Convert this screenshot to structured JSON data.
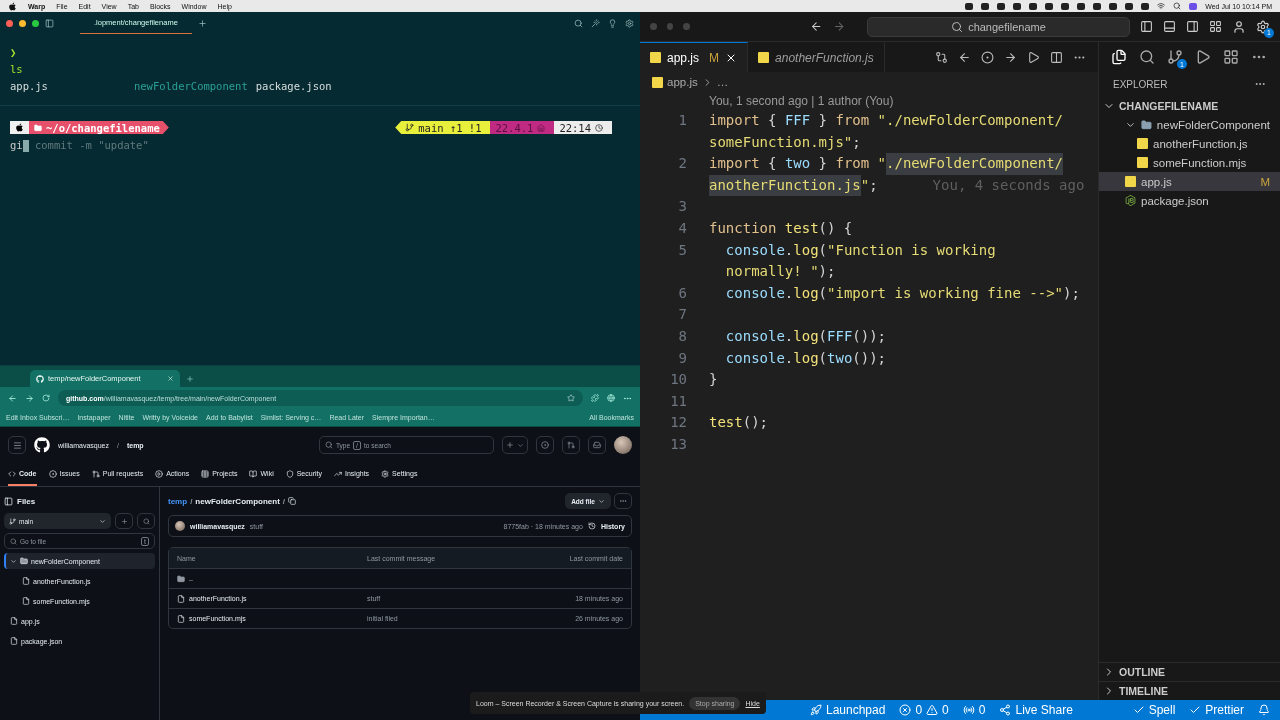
{
  "menubar": {
    "app_name": "Warp",
    "menus": [
      "File",
      "Edit",
      "View",
      "Tab",
      "Blocks",
      "Window",
      "Help"
    ],
    "clock": "Wed Jul 10  10:14 PM"
  },
  "terminal": {
    "tab_title": ".lopment/changefilename",
    "prompt_symbol": "❯",
    "command": "ls",
    "output": [
      {
        "text": "app.js",
        "kind": "file"
      },
      {
        "text": "newFolderComponent",
        "kind": "dir"
      },
      {
        "text": "package.json",
        "kind": "file"
      }
    ],
    "prompt": {
      "path": "~/o/changefilename",
      "branch": "main ↑1 !1",
      "node": "22.4.1",
      "time": "22:14"
    },
    "input": {
      "typed": "gi",
      "suggestion": " commit -m \"update\""
    }
  },
  "browser": {
    "tab_title": "temp/newFolderComponent",
    "url_host": "github.com",
    "url_path": "/williamavasquez/temp/tree/main/newFolderComponent",
    "bookmarks": [
      "Edit Inbox Subscri…",
      "Instapaper",
      "Nitite",
      "Writty by Voiceide",
      "Add to Babylist",
      "Simlist: Serving c…",
      "Read Later",
      "Siempre Importan…"
    ],
    "all_bookmarks": "All Bookmarks"
  },
  "github": {
    "owner": "williamavasquez",
    "separator": "/",
    "repo": "temp",
    "search": {
      "before": "Type",
      "key": "/",
      "after": "to search"
    },
    "nav": [
      {
        "label": "Code",
        "selected": true
      },
      {
        "label": "Issues",
        "selected": false
      },
      {
        "label": "Pull requests",
        "selected": false
      },
      {
        "label": "Actions",
        "selected": false
      },
      {
        "label": "Projects",
        "selected": false
      },
      {
        "label": "Wiki",
        "selected": false
      },
      {
        "label": "Security",
        "selected": false
      },
      {
        "label": "Insights",
        "selected": false
      },
      {
        "label": "Settings",
        "selected": false
      }
    ],
    "files_title": "Files",
    "branch": "main",
    "go_to_file": {
      "placeholder": "Go to file",
      "key": "t"
    },
    "tree": [
      {
        "name": "newFolderComponent",
        "kind": "folder",
        "expanded": true,
        "selected": true,
        "children": [
          {
            "name": "anotherFunction.js",
            "kind": "file",
            "selected": false
          },
          {
            "name": "someFunction.mjs",
            "kind": "file",
            "selected": false
          }
        ]
      },
      {
        "name": "app.js",
        "kind": "file",
        "selected": false
      },
      {
        "name": "package.json",
        "kind": "file",
        "selected": false
      }
    ],
    "breadcrumb": [
      "temp",
      "newFolderComponent"
    ],
    "add_file": "Add file",
    "commit": {
      "author": "williamavasquez",
      "message": "stuff",
      "hash": "8775fab · 18 minutes ago",
      "history": "History"
    },
    "table": {
      "columns": [
        "Name",
        "Last commit message",
        "Last commit date"
      ],
      "rows": [
        {
          "kind": "parent",
          "name": ".."
        },
        {
          "kind": "file",
          "name": "anotherFunction.js",
          "message": "stuff",
          "date": "18 minutes ago"
        },
        {
          "kind": "file",
          "name": "someFunction.mjs",
          "message": "initial filed",
          "date": "26 minutes ago"
        }
      ]
    }
  },
  "vscode": {
    "search": "changefilename",
    "settings_badge": "1",
    "scm_badge": "1",
    "tabs": [
      {
        "label": "app.js",
        "status": "M",
        "selected": true,
        "preview": false
      },
      {
        "label": "anotherFunction.js",
        "selected": false,
        "preview": true
      }
    ],
    "breadcrumb": [
      "app.js",
      "…"
    ],
    "codelens": "You, 1 second ago | 1 author (You)",
    "lines": [
      {
        "number": "1",
        "rows": [
          {
            "tokens": [
              {
                "kind": "keyword",
                "text": "import"
              },
              {
                "kind": "punct",
                "text": " { "
              },
              {
                "kind": "variable",
                "text": "FFF"
              },
              {
                "kind": "punct",
                "text": " } "
              },
              {
                "kind": "keyword",
                "text": "from"
              },
              {
                "kind": "string",
                "text": " \"./newFolderComponent/"
              }
            ]
          },
          {
            "tokens": [
              {
                "kind": "string",
                "text": "someFunction.mjs\""
              },
              {
                "kind": "punct",
                "text": ";"
              }
            ]
          }
        ]
      },
      {
        "number": "2",
        "rows": [
          {
            "tokens": [
              {
                "kind": "keyword",
                "text": "import"
              },
              {
                "kind": "punct",
                "text": " { "
              },
              {
                "kind": "variable",
                "text": "two"
              },
              {
                "kind": "punct",
                "text": " } "
              },
              {
                "kind": "keyword",
                "text": "from"
              },
              {
                "kind": "string",
                "text": " \""
              },
              {
                "kind": "selection",
                "text": "./newFolderComponent/"
              }
            ]
          },
          {
            "tokens": [
              {
                "kind": "selection",
                "text": "anotherFunction.js"
              },
              {
                "kind": "string",
                "text": "\""
              },
              {
                "kind": "punct",
                "text": ";"
              }
            ]
          }
        ],
        "blame": "You, 4 seconds ago"
      },
      {
        "number": "3"
      },
      {
        "number": "4",
        "rows": [
          {
            "tokens": [
              {
                "kind": "keyword",
                "text": "function "
              },
              {
                "kind": "function",
                "text": "test"
              },
              {
                "kind": "punct",
                "text": "() {"
              }
            ]
          }
        ]
      },
      {
        "number": "5",
        "rows": [
          {
            "tokens": [
              {
                "kind": "variable",
                "text": "  console"
              },
              {
                "kind": "punct",
                "text": "."
              },
              {
                "kind": "function",
                "text": "log"
              },
              {
                "kind": "punct",
                "text": "("
              },
              {
                "kind": "string",
                "text": "\"Function is working"
              }
            ]
          },
          {
            "tokens": [
              {
                "kind": "string",
                "text": "  normally! \""
              },
              {
                "kind": "punct",
                "text": ");"
              }
            ]
          }
        ]
      },
      {
        "number": "6",
        "rows": [
          {
            "tokens": [
              {
                "kind": "variable",
                "text": "  console"
              },
              {
                "kind": "punct",
                "text": "."
              },
              {
                "kind": "function",
                "text": "log"
              },
              {
                "kind": "punct",
                "text": "("
              },
              {
                "kind": "string",
                "text": "\"import is working fine -->\""
              },
              {
                "kind": "punct",
                "text": ");"
              }
            ]
          }
        ]
      },
      {
        "number": "7"
      },
      {
        "number": "8",
        "rows": [
          {
            "tokens": [
              {
                "kind": "variable",
                "text": "  console"
              },
              {
                "kind": "punct",
                "text": "."
              },
              {
                "kind": "function",
                "text": "log"
              },
              {
                "kind": "punct",
                "text": "("
              },
              {
                "kind": "variable",
                "text": "FFF"
              },
              {
                "kind": "punct",
                "text": "());"
              }
            ]
          }
        ]
      },
      {
        "number": "9",
        "rows": [
          {
            "tokens": [
              {
                "kind": "variable",
                "text": "  console"
              },
              {
                "kind": "punct",
                "text": "."
              },
              {
                "kind": "function",
                "text": "log"
              },
              {
                "kind": "punct",
                "text": "("
              },
              {
                "kind": "variable",
                "text": "two"
              },
              {
                "kind": "punct",
                "text": "());"
              }
            ]
          }
        ]
      },
      {
        "number": "10",
        "rows": [
          {
            "tokens": [
              {
                "kind": "punct",
                "text": "}"
              }
            ]
          }
        ]
      },
      {
        "number": "11"
      },
      {
        "number": "12",
        "rows": [
          {
            "tokens": [
              {
                "kind": "function",
                "text": "test"
              },
              {
                "kind": "punct",
                "text": "();"
              }
            ]
          }
        ]
      },
      {
        "number": "13"
      }
    ],
    "explorer": {
      "title": "EXPLORER",
      "root": "CHANGEFILENAME",
      "expanded": true,
      "tree": [
        {
          "name": "newFolderComponent",
          "kind": "folder",
          "expanded": true,
          "selected": false,
          "children": [
            {
              "name": "anotherFunction.js",
              "kind": "js",
              "selected": false
            },
            {
              "name": "someFunction.mjs",
              "kind": "js",
              "selected": false
            }
          ]
        },
        {
          "name": "app.js",
          "kind": "js",
          "selected": true,
          "status": "M"
        },
        {
          "name": "package.json",
          "kind": "json",
          "selected": false
        }
      ],
      "sections": [
        {
          "label": "OUTLINE",
          "expanded": false
        },
        {
          "label": "TIMELINE",
          "expanded": false
        }
      ]
    },
    "status_bar": [
      {
        "kind": "launchpad",
        "text": "Launchpad"
      },
      {
        "kind": "problems",
        "errors": "0",
        "warnings": "0"
      },
      {
        "kind": "ports",
        "text": "0"
      },
      {
        "kind": "liveshare",
        "text": "Live Share"
      },
      {
        "kind": "spacer"
      },
      {
        "kind": "check",
        "text": "Spell"
      },
      {
        "kind": "check",
        "text": "Prettier"
      },
      {
        "kind": "bell"
      }
    ]
  },
  "loom": {
    "message": "Loom – Screen Recorder & Screen Capture is sharing your screen.",
    "stop": "Stop sharing",
    "hide": "Hide"
  }
}
